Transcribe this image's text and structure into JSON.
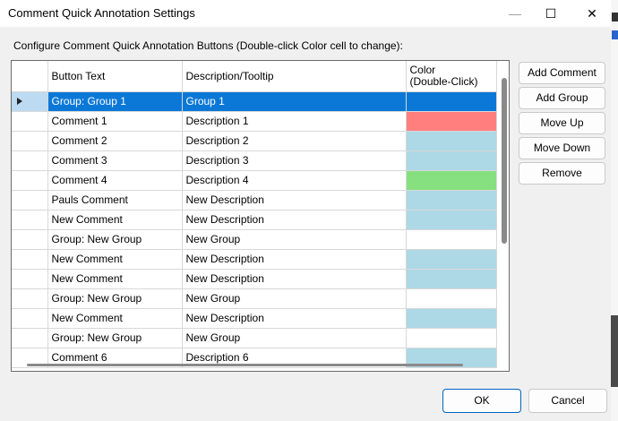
{
  "window": {
    "title": "Comment Quick Annotation Settings",
    "minimize_glyph": "—",
    "maximize_glyph": "☐",
    "close_glyph": "✕"
  },
  "instruction": "Configure Comment Quick Annotation Buttons (Double-click Color cell to change):",
  "grid": {
    "headers": {
      "button_text": "Button Text",
      "description": "Description/Tooltip",
      "color_line1": "Color",
      "color_line2": "(Double-Click)"
    },
    "rows": [
      {
        "button_text": "Group: Group 1",
        "description": "Group 1",
        "color": "#0b78d7",
        "selected": true
      },
      {
        "button_text": "Comment 1",
        "description": "Description 1",
        "color": "#ff7f7f"
      },
      {
        "button_text": "Comment 2",
        "description": "Description 2",
        "color": "#add8e6"
      },
      {
        "button_text": "Comment 3",
        "description": "Description 3",
        "color": "#add8e6"
      },
      {
        "button_text": "Comment 4",
        "description": "Description 4",
        "color": "#86e080"
      },
      {
        "button_text": "Pauls Comment",
        "description": "New Description",
        "color": "#add8e6"
      },
      {
        "button_text": "New Comment",
        "description": "New Description",
        "color": "#add8e6"
      },
      {
        "button_text": "Group: New Group",
        "description": "New Group",
        "color": "#ffffff"
      },
      {
        "button_text": "New Comment",
        "description": "New Description",
        "color": "#add8e6"
      },
      {
        "button_text": "New Comment",
        "description": "New Description",
        "color": "#add8e6"
      },
      {
        "button_text": "Group: New Group",
        "description": "New Group",
        "color": "#ffffff"
      },
      {
        "button_text": "New Comment",
        "description": "New Description",
        "color": "#add8e6"
      },
      {
        "button_text": "Group: New Group",
        "description": "New Group",
        "color": "#ffffff"
      },
      {
        "button_text": "Comment 6",
        "description": "Description 6",
        "color": "#add8e6"
      }
    ]
  },
  "side_buttons": {
    "add_comment": "Add Comment",
    "add_group": "Add Group",
    "move_up": "Move Up",
    "move_down": "Move Down",
    "remove": "Remove"
  },
  "footer": {
    "ok": "OK",
    "cancel": "Cancel"
  }
}
